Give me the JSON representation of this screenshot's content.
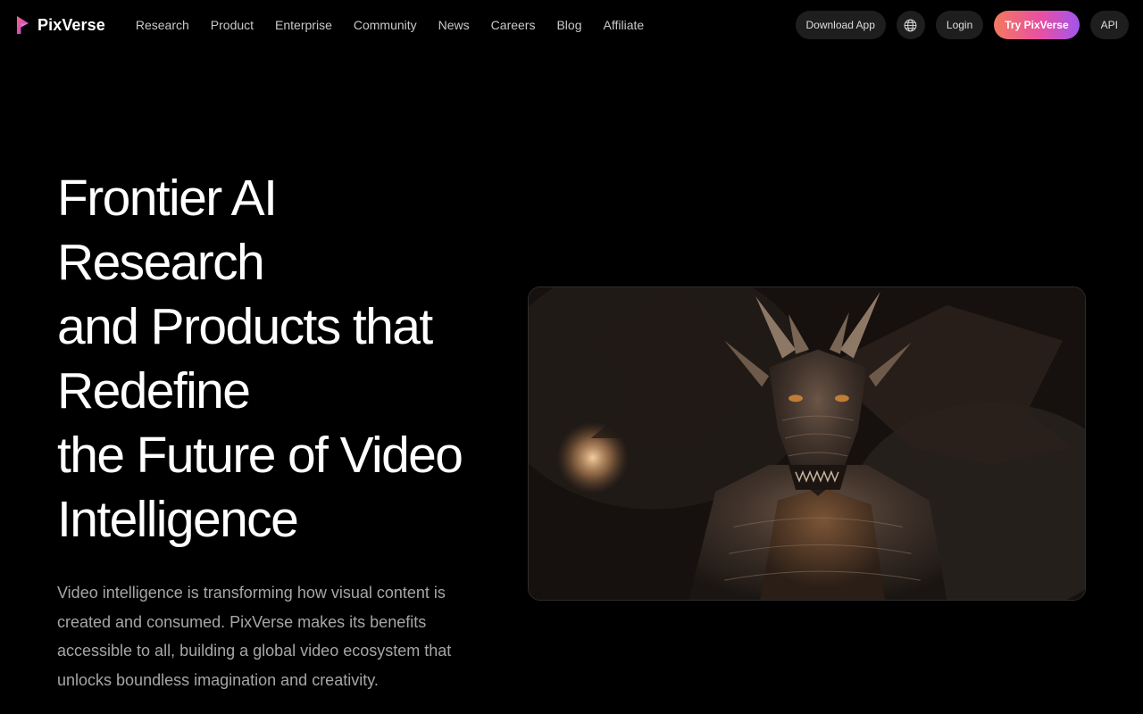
{
  "brand": {
    "name": "PixVerse"
  },
  "nav": {
    "links": [
      "Research",
      "Product",
      "Enterprise",
      "Community",
      "News",
      "Careers",
      "Blog",
      "Affiliate"
    ],
    "download_label": "Download App",
    "login_label": "Login",
    "try_label": "Try PixVerse",
    "api_label": "API"
  },
  "hero": {
    "title_lines": [
      "Frontier AI",
      "Research",
      "and Products that",
      "Redefine",
      "the Future of Video",
      "Intelligence"
    ],
    "description": "Video intelligence is transforming how visual content is created and consumed. PixVerse makes its benefits accessible to all, building a global video ecosystem that unlocks boundless imagination and creativity."
  },
  "colors": {
    "background": "#000000",
    "accent_gradient": [
      "#f27a5e",
      "#e84fa3",
      "#a255ef"
    ],
    "muted_text": "#a6a6a6"
  },
  "icons": {
    "globe": "globe-icon",
    "logo": "pixverse-logo-icon"
  }
}
